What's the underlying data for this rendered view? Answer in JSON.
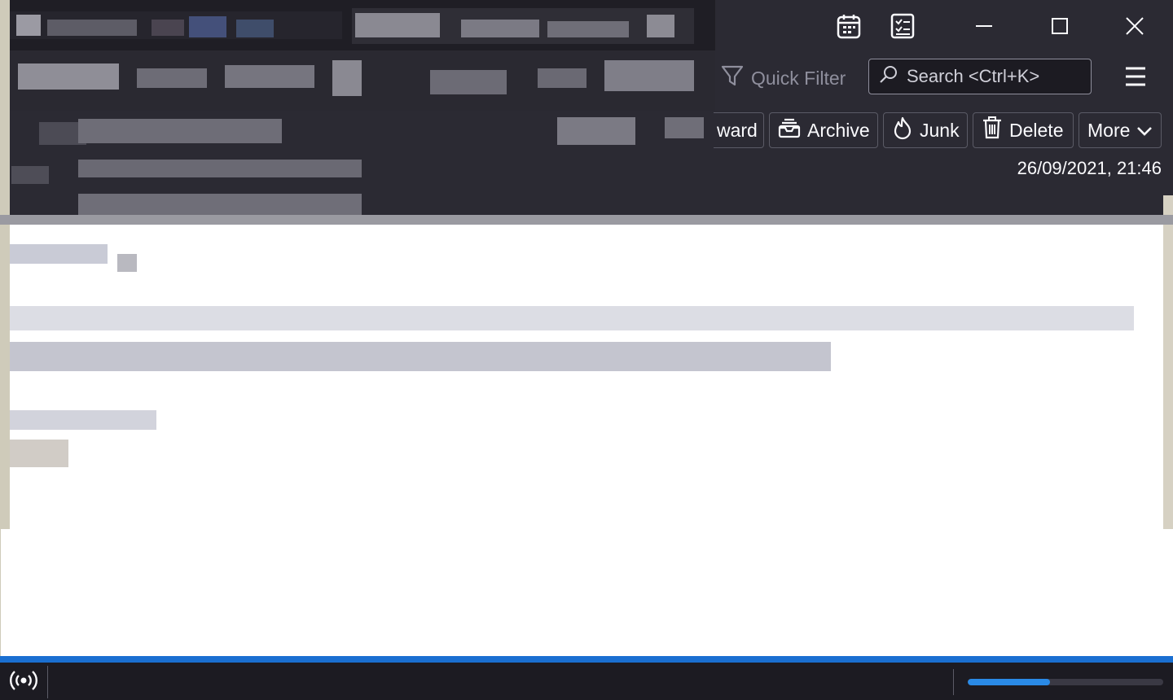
{
  "window": {
    "calendar_icon": "calendar-icon",
    "tasks_icon": "tasks-icon",
    "minimize_icon": "minimize-icon",
    "maximize_icon": "maximize-icon",
    "close_icon": "close-icon"
  },
  "toolbar": {
    "quick_filter_label": "Quick Filter",
    "search_placeholder": "Search <Ctrl+K>",
    "menu_icon": "hamburger-menu-icon"
  },
  "message_header": {
    "actions": {
      "forward_label": "ward",
      "archive_label": "Archive",
      "junk_label": "Junk",
      "delete_label": "Delete",
      "more_label": "More"
    },
    "date": "26/09/2021, 21:46"
  },
  "status_bar": {
    "online_icon": "online-status-icon",
    "progress": 0.42
  },
  "colors": {
    "header_bg": "#2b2a33",
    "accent": "#1a6fd1",
    "status_bg": "#1c1b22"
  }
}
